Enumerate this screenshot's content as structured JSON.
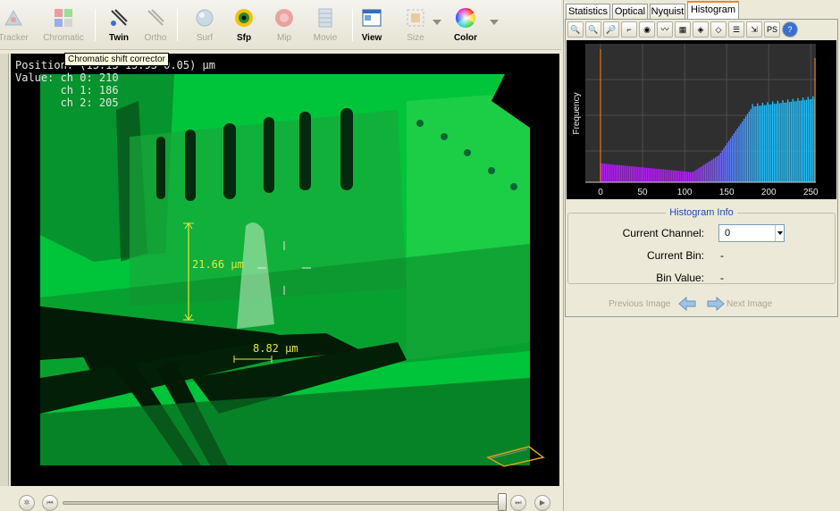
{
  "toolbar": {
    "buttons": [
      {
        "id": "tracker",
        "label": "Tracker",
        "icon": "tracker-icon"
      },
      {
        "id": "chromatic",
        "label": "Chromatic",
        "icon": "chromatic-icon"
      },
      {
        "id": "twin",
        "label": "Twin",
        "icon": "twin-icon"
      },
      {
        "id": "ortho",
        "label": "Ortho",
        "icon": "ortho-icon"
      },
      {
        "id": "surf",
        "label": "Surf",
        "icon": "surf-icon"
      },
      {
        "id": "sfp",
        "label": "Sfp",
        "icon": "sfp-icon"
      },
      {
        "id": "mip",
        "label": "Mip",
        "icon": "mip-icon"
      },
      {
        "id": "movie",
        "label": "Movie",
        "icon": "movie-icon"
      },
      {
        "id": "view",
        "label": "View",
        "icon": "view-icon"
      },
      {
        "id": "size",
        "label": "Size",
        "icon": "size-icon"
      },
      {
        "id": "color",
        "label": "Color",
        "icon": "color-wheel-icon"
      }
    ],
    "tooltip": "Chromatic shift corrector"
  },
  "overlay": {
    "position_line": "Position: (13.13 13.93 0.05) µm",
    "value_line": "Value: ch 0: 210",
    "ch1_line": "       ch 1: 186",
    "ch2_line": "       ch 2: 205",
    "measure_vertical": "21.66 µm",
    "measure_horizontal": "8.82 µm"
  },
  "tabs": [
    "Statistics",
    "Optical",
    "Nyquist",
    "Histogram"
  ],
  "active_tab": "Histogram",
  "histogram": {
    "ylabel": "Frequency",
    "x_ticks": [
      "0",
      "50",
      "100",
      "150",
      "200",
      "250"
    ],
    "xlim": [
      0,
      255
    ]
  },
  "hist_info": {
    "title": "Histogram Info",
    "current_channel_label": "Current Channel:",
    "current_channel_value": "0",
    "current_bin_label": "Current Bin:",
    "current_bin_value": "-",
    "bin_value_label": "Bin Value:",
    "bin_value_value": "-"
  },
  "navigation": {
    "previous": "Previous Image",
    "next": "Next Image"
  },
  "colors": {
    "green_channel": "#00c43a",
    "measure_color": "#e8e63a",
    "histogram_low": "#b81cff",
    "histogram_high": "#1ec0ff"
  }
}
